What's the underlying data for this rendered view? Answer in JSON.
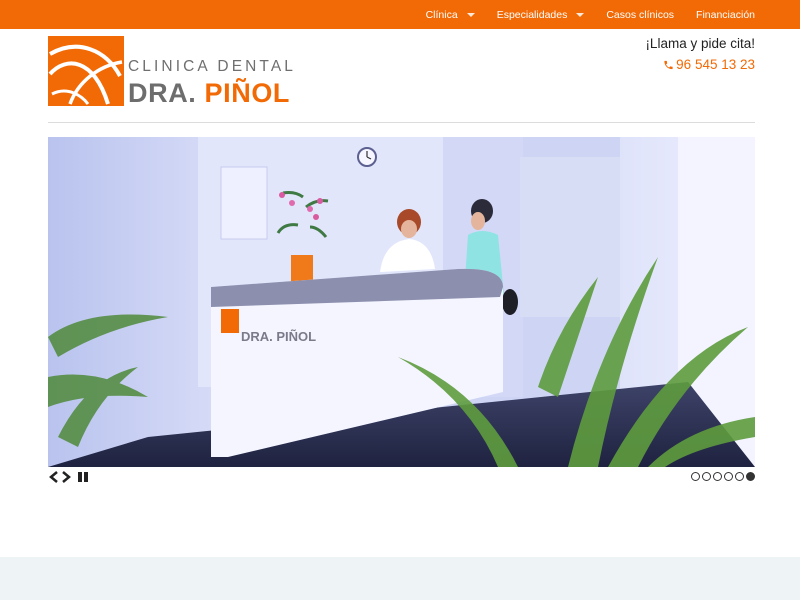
{
  "nav": {
    "items": [
      {
        "label": "Clínica",
        "has_dropdown": true
      },
      {
        "label": "Especialidades",
        "has_dropdown": true
      },
      {
        "label": "Casos clínicos",
        "has_dropdown": false
      },
      {
        "label": "Financiación",
        "has_dropdown": false
      }
    ]
  },
  "logo": {
    "line1": "CLINICA DENTAL",
    "line2_dark": "DRA.",
    "line2_orange": "PIÑOL"
  },
  "cta": {
    "text": "¡Llama y pide cita!",
    "phone": "96 545 13 23",
    "phone_icon": "phone-icon"
  },
  "slider": {
    "image": "reception-desk-photo",
    "desk_sign": "DRA. PIÑOL",
    "controls": [
      "prev-icon",
      "next-icon",
      "pause-icon"
    ],
    "slide_count": 6,
    "active_slide": 6
  },
  "colors": {
    "brand_orange": "#f26a05",
    "logo_gray": "#6d6d6d",
    "footer_band": "#eef4f5"
  }
}
